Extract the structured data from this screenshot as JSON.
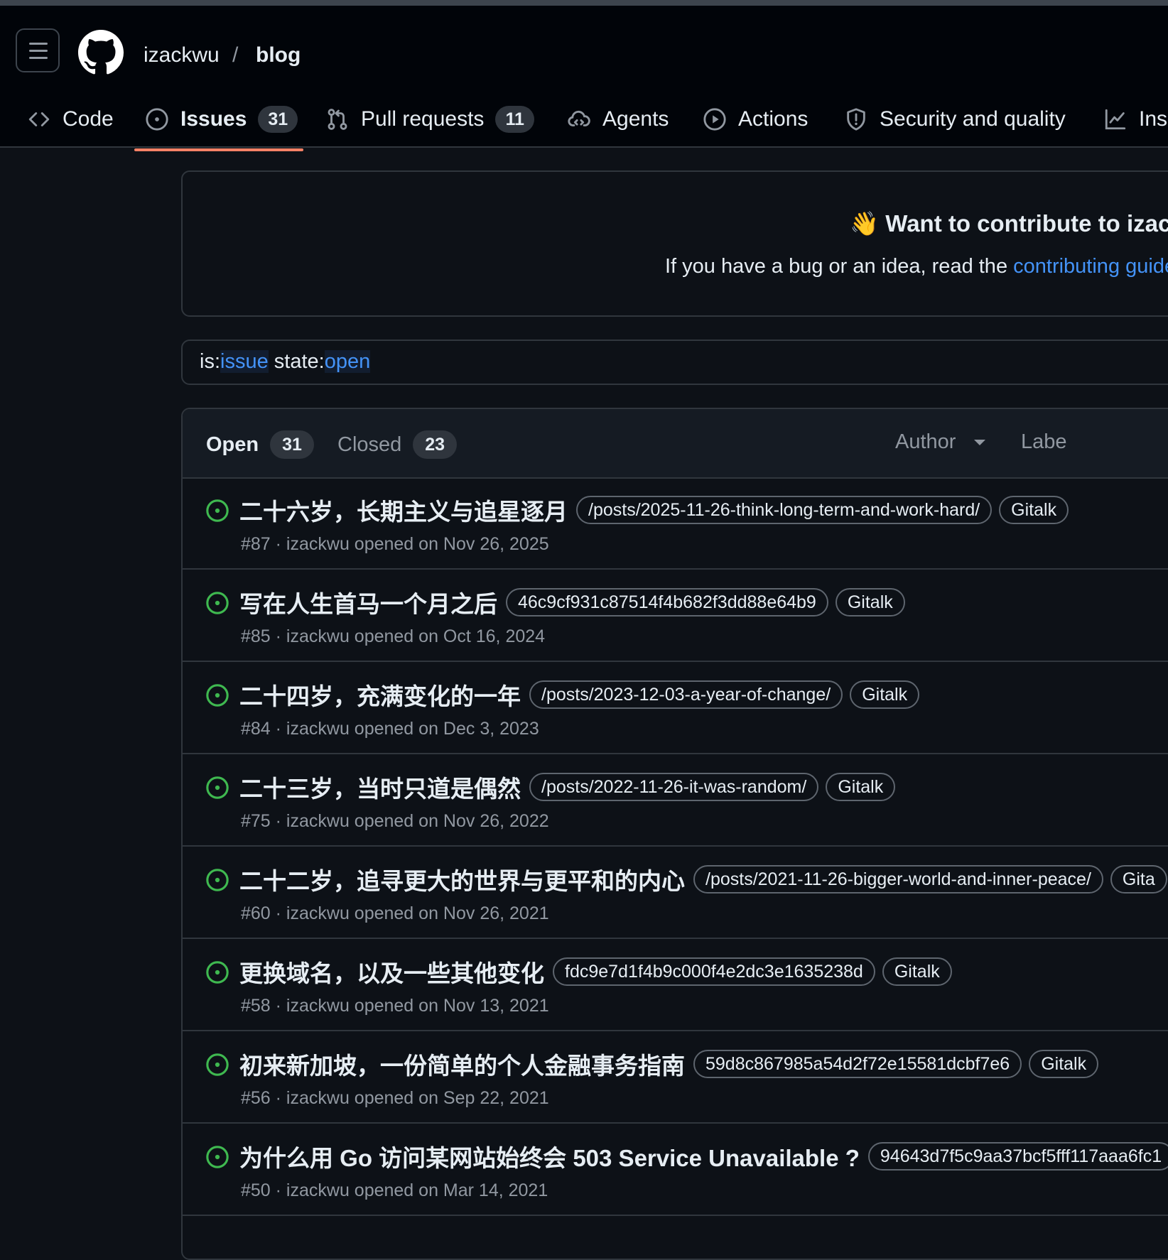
{
  "header": {
    "owner": "izackwu",
    "separator": "/",
    "repo": "blog"
  },
  "tabs": [
    {
      "label": "Code",
      "icon": "code-icon"
    },
    {
      "label": "Issues",
      "count": "31",
      "icon": "issue-opened-icon",
      "active": true
    },
    {
      "label": "Pull requests",
      "count": "11",
      "icon": "git-pull-request-icon"
    },
    {
      "label": "Agents",
      "icon": "agent-icon"
    },
    {
      "label": "Actions",
      "icon": "play-icon"
    },
    {
      "label": "Security and quality",
      "icon": "shield-icon"
    },
    {
      "label": "Insi",
      "icon": "graph-icon"
    }
  ],
  "banner": {
    "emoji": "👋",
    "title": "Want to contribute to izack",
    "text_before": "If you have a bug or an idea, read the ",
    "link": "contributing guide"
  },
  "search": {
    "key1": "is:",
    "val1": "issue",
    "key2": " state:",
    "val2": "open"
  },
  "list": {
    "open_label": "Open",
    "open_count": "31",
    "closed_label": "Closed",
    "closed_count": "23",
    "filters": [
      "Author",
      "Labe"
    ]
  },
  "issues": [
    {
      "title": "二十六岁，长期主义与追星逐月",
      "labels": [
        "/posts/2025-11-26-think-long-term-and-work-hard/",
        "Gitalk"
      ],
      "meta": "#87 · izackwu opened on Nov 26, 2025"
    },
    {
      "title": "写在人生首马一个月之后",
      "labels": [
        "46c9cf931c87514f4b682f3dd88e64b9",
        "Gitalk"
      ],
      "meta": "#85 · izackwu opened on Oct 16, 2024"
    },
    {
      "title": "二十四岁，充满变化的一年",
      "labels": [
        "/posts/2023-12-03-a-year-of-change/",
        "Gitalk"
      ],
      "meta": "#84 · izackwu opened on Dec 3, 2023"
    },
    {
      "title": "二十三岁，当时只道是偶然",
      "labels": [
        "/posts/2022-11-26-it-was-random/",
        "Gitalk"
      ],
      "meta": "#75 · izackwu opened on Nov 26, 2022"
    },
    {
      "title": "二十二岁，追寻更大的世界与更平和的内心",
      "labels": [
        "/posts/2021-11-26-bigger-world-and-inner-peace/",
        "Gita"
      ],
      "meta": "#60 · izackwu opened on Nov 26, 2021"
    },
    {
      "title": "更换域名，以及一些其他变化",
      "labels": [
        "fdc9e7d1f4b9c000f4e2dc3e1635238d",
        "Gitalk"
      ],
      "meta": "#58 · izackwu opened on Nov 13, 2021"
    },
    {
      "title": "初来新加坡，一份简单的个人金融事务指南",
      "labels": [
        "59d8c867985a54d2f72e15581dcbf7e6",
        "Gitalk"
      ],
      "meta": "#56 · izackwu opened on Sep 22, 2021"
    },
    {
      "title": "为什么用 Go 访问某网站始终会 503 Service Unavailable ?",
      "labels": [
        "94643d7f5c9aa37bcf5fff117aaa6fc1"
      ],
      "meta": "#50 · izackwu opened on Mar 14, 2021"
    }
  ],
  "colors": {
    "accent_link": "#4493f8",
    "open_green": "#3fb950",
    "tab_underline": "#f78166"
  }
}
